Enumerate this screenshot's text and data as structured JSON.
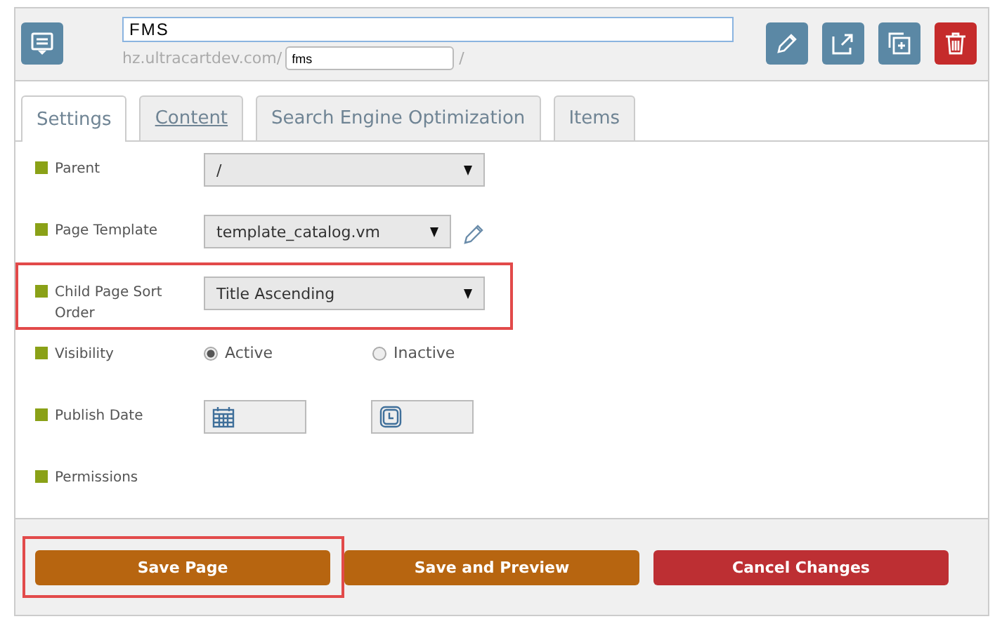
{
  "header": {
    "title": "FMS",
    "url_prefix": "hz.ultracartdev.com/",
    "slug": "fms",
    "url_suffix": "/"
  },
  "tabs": [
    {
      "label": "Settings",
      "selected": true,
      "link": false
    },
    {
      "label": "Content",
      "selected": false,
      "link": true
    },
    {
      "label": "Search Engine Optimization",
      "selected": false,
      "link": false
    },
    {
      "label": "Items",
      "selected": false,
      "link": false
    }
  ],
  "fields": [
    {
      "kind": "select",
      "label": "Parent",
      "value": "/",
      "highlighted": false
    },
    {
      "kind": "select_edit",
      "label": "Page Template",
      "value": "template_catalog.vm",
      "highlighted": false
    },
    {
      "kind": "select",
      "label": "Child Page Sort Order",
      "value": "Title Ascending",
      "highlighted": true
    },
    {
      "kind": "radio",
      "label": "Visibility",
      "options": [
        {
          "label": "Active",
          "selected": true
        },
        {
          "label": "Inactive",
          "selected": false
        }
      ],
      "highlighted": false
    },
    {
      "kind": "datetime",
      "label": "Publish Date",
      "highlighted": false
    },
    {
      "kind": "none",
      "label": "Permissions",
      "highlighted": false
    }
  ],
  "buttons": [
    {
      "label": "Save Page",
      "kind": "primary",
      "highlighted": true
    },
    {
      "label": "Save and Preview",
      "kind": "primary",
      "highlighted": false
    },
    {
      "label": "Cancel Changes",
      "kind": "danger",
      "highlighted": false
    }
  ]
}
